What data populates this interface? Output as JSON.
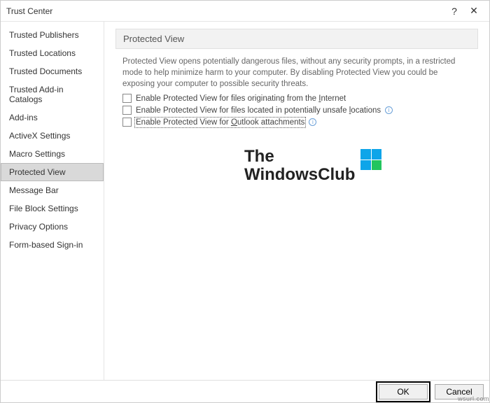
{
  "titlebar": {
    "title": "Trust Center",
    "help": "?",
    "close": "✕"
  },
  "sidebar": {
    "selected": 6,
    "items": [
      "Trusted Publishers",
      "Trusted Locations",
      "Trusted Documents",
      "Trusted Add-in Catalogs",
      "Add-ins",
      "ActiveX Settings",
      "Macro Settings",
      "Protected View",
      "Message Bar",
      "File Block Settings",
      "Privacy Options",
      "Form-based Sign-in"
    ]
  },
  "main": {
    "header": "Protected View",
    "description": "Protected View opens potentially dangerous files, without any security prompts, in a restricted mode to help minimize harm to your computer. By disabling Protected View you could be exposing your computer to possible security threats.",
    "options": [
      {
        "label_pre": "Enable Protected View for files originating from the ",
        "u": "I",
        "label_post": "nternet",
        "info": false,
        "focus": false
      },
      {
        "label_pre": "Enable Protected View for files located in potentially unsafe ",
        "u": "l",
        "label_post": "ocations",
        "info": true,
        "focus": false
      },
      {
        "label_pre": "Enable Protected View for ",
        "u": "O",
        "label_post": "utlook attachments",
        "info": true,
        "focus": true
      }
    ]
  },
  "watermark": {
    "line1": "The",
    "line2": "WindowsClub"
  },
  "footer": {
    "ok": "OK",
    "cancel": "Cancel"
  },
  "corner": "wsurl.com"
}
